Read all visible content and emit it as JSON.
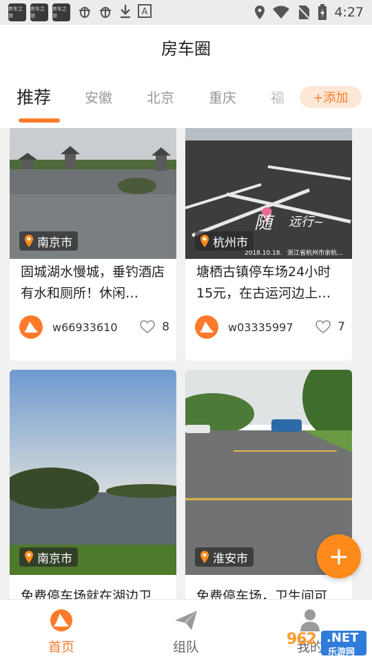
{
  "status_bar": {
    "time": "4:27",
    "app_icons": [
      "房车之旅",
      "房车之旅",
      "房车之旅"
    ],
    "icons": [
      "bug-icon",
      "bug-icon",
      "download-icon",
      "a-icon",
      "location-icon",
      "wifi-icon",
      "no-sim-icon",
      "battery-icon"
    ]
  },
  "header": {
    "title": "房车圈"
  },
  "tabs": {
    "items": [
      "推荐",
      "安徽",
      "北京",
      "重庆",
      "福"
    ],
    "active": "推荐",
    "add_label": "+添加"
  },
  "posts": [
    {
      "location": "南京市",
      "title": "固城湖水慢城，垂钓酒店有水和厕所！休闲…",
      "user": "w66933610",
      "likes": "8"
    },
    {
      "location": "杭州市",
      "title": "塘栖古镇停车场24小时15元，在古运河边上…",
      "user": "w03335997",
      "likes": "7",
      "photo_stamp": "2018.10.18.",
      "photo_caption": "浙江省杭州市余杭…"
    },
    {
      "location": "南京市",
      "title": "免费停车场就在湖边卫",
      "user": "",
      "likes": ""
    },
    {
      "location": "淮安市",
      "title": "免费停车场，卫生间可",
      "user": "",
      "likes": ""
    }
  ],
  "fab": {
    "label": "+"
  },
  "bottom_nav": [
    {
      "label": "首页",
      "active": true
    },
    {
      "label": "组队",
      "active": false
    },
    {
      "label": "我的",
      "active": false
    }
  ],
  "watermark": {
    "text": "962",
    "net": ".NET",
    "sub": "乐游网"
  },
  "colors": {
    "accent": "#ff7a2b",
    "fab": "#ff8a1c",
    "background": "#f1f1f1"
  }
}
